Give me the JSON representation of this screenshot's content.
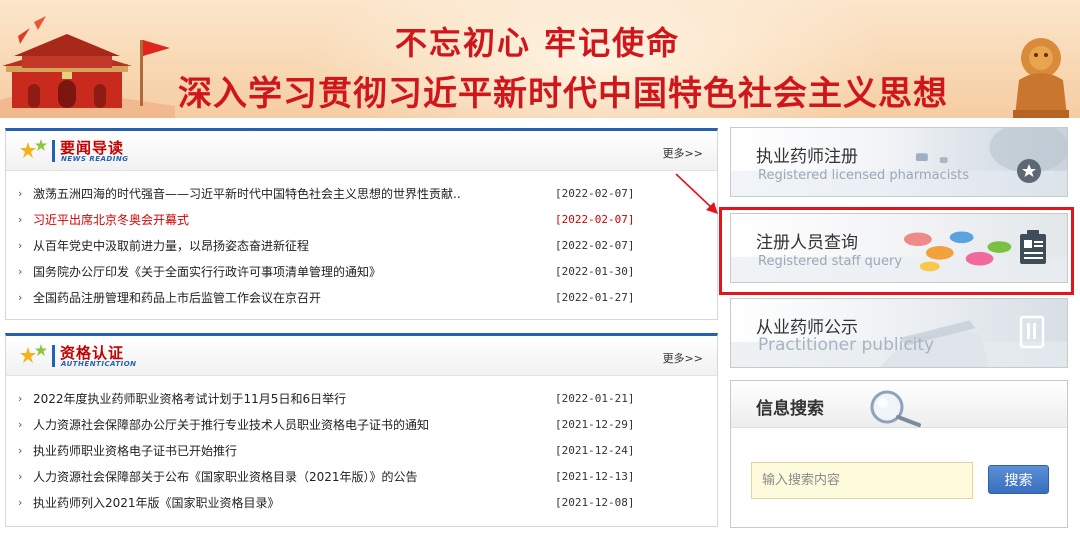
{
  "banner": {
    "line1": "不忘初心 牢记使命",
    "line2": "深入学习贯彻习近平新时代中国特色社会主义思想"
  },
  "news": {
    "title": "要闻导读",
    "subtitle": "NEWS READING",
    "more": "更多>>",
    "items": [
      {
        "title": "激荡五洲四海的时代强音——习近平新时代中国特色社会主义思想的世界性贡献..",
        "date": "[2022-02-07]"
      },
      {
        "title": "习近平出席北京冬奥会开幕式",
        "date": "[2022-02-07]"
      },
      {
        "title": "从百年党史中汲取前进力量，以昂扬姿态奋进新征程",
        "date": "[2022-02-07]"
      },
      {
        "title": "国务院办公厅印发《关于全面实行行政许可事项清单管理的通知》",
        "date": "[2022-01-30]"
      },
      {
        "title": "全国药品注册管理和药品上市后监管工作会议在京召开",
        "date": "[2022-01-27]"
      }
    ]
  },
  "cert": {
    "title": "资格认证",
    "subtitle": "AUTHENTICATION",
    "more": "更多>>",
    "items": [
      {
        "title": "2022年度执业药师职业资格考试计划于11月5日和6日举行",
        "date": "[2022-01-21]"
      },
      {
        "title": "人力资源社会保障部办公厅关于推行专业技术人员职业资格电子证书的通知",
        "date": "[2021-12-29]"
      },
      {
        "title": "执业药师职业资格电子证书已开始推行",
        "date": "[2021-12-24]"
      },
      {
        "title": "人力资源社会保障部关于公布《国家职业资格目录（2021年版）》的公告",
        "date": "[2021-12-13]"
      },
      {
        "title": "执业药师列入2021年版《国家职业资格目录》",
        "date": "[2021-12-08]"
      }
    ]
  },
  "cards": {
    "register": {
      "cn": "执业药师注册",
      "en": "Registered licensed pharmacists"
    },
    "query": {
      "cn": "注册人员查询",
      "en": "Registered staff query"
    },
    "publicity": {
      "cn": "从业药师公示",
      "en": "Practitioner publicity"
    }
  },
  "search": {
    "title": "信息搜索",
    "placeholder": "输入搜索内容",
    "button": "搜索"
  },
  "colors": {
    "banner_red": "#d0161b",
    "accent_blue": "#2560b5",
    "highlight_red": "#e0161b",
    "news_highlight": "#d40000"
  }
}
